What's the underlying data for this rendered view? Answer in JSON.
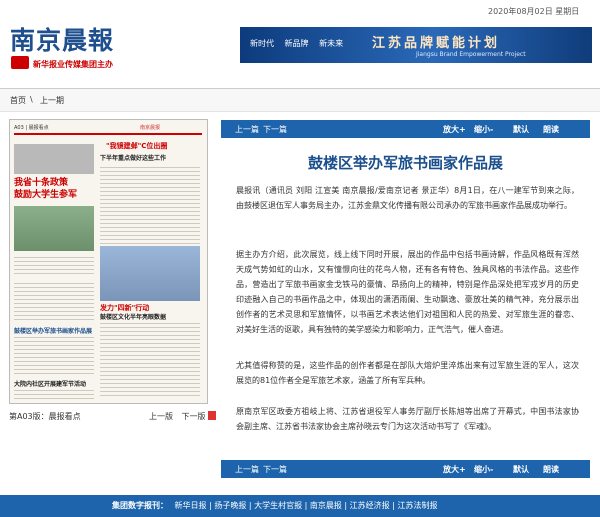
{
  "header": {
    "date": "2020年08月02日 星期日",
    "logo": "南京晨報",
    "org": "新华报业传媒集团主办",
    "banner": {
      "links": [
        "新时代",
        "新品牌",
        "新未来"
      ],
      "title": "江苏品牌赋能计划",
      "subtitle": "Jiangsu Brand Empowerment Project"
    }
  },
  "nav": {
    "home": "首页",
    "sep": "\\",
    "prev": "上一期"
  },
  "paper_thumb": {
    "header_left": "A03 | 晨报看点",
    "header_right": "南京晨报",
    "headline1": "\"我镜建邺\"C位出圈",
    "headline1_sub": "下半年重点做好这些工作",
    "headline2": "我省十条政策",
    "headline3": "鼓励大学生参军",
    "headline4": "发力\"四新\"行动",
    "headline4_sub": "鼓楼区文化半年亮眼数据",
    "headline5": "鼓楼区举办军旅书画家作品展",
    "headline6": "大院内社区开展建军节活动"
  },
  "page_nav": {
    "label": "第A03版：晨报看点",
    "prev_page": "上一版",
    "next_page": "下一版"
  },
  "toolbar": {
    "prev": "上一篇",
    "next": "下一篇",
    "zoom_in": "放大+",
    "zoom_out": "缩小-",
    "default": "默认",
    "read": "朗读"
  },
  "article": {
    "title": "鼓楼区举办军旅书画家作品展",
    "paragraphs": [
      "晨报讯（通讯员 刘阳 江宣美 南京晨报/爱南京记者 景正华）8月1日，在八一建军节到来之际，由鼓楼区退伍军人事务局主办，江苏金鼎文化传播有限公司承办的军旅书画家作品展成功举行。",
      "据主办方介绍，此次展览，线上线下同时开展，展出的作品中包括书画诗解，作品风格既有浑然天成气势如虹的山水，又有憧憬向往的花鸟人物，还有各有特色、独具风格的书法作品。这些作品，营造出了军旅书画家金戈铁马的豪情、昂扬向上的精神，特别是作品深处把军戎岁月的历史印迹融入自己的书画作品之中，体现出的潇洒雨阑、生动飘逸、豪放壮美的精气神，充分展示出创作者的艺术灵思和军旅情怀，以书画艺术表达他们对祖国和人民的热爱、对军旅生涯的眷恋、对美好生活的讴歌，具有独特的美学感染力和影响力，正气浩气，催人奋进。",
      "尤其值得称赞的是，这些作品的创作者都是在部队大熔炉里淬炼出来有过军旅生涯的军人，这次展览的81位作者全是军旅艺术家，涵盖了所有军兵种。",
      "原南京军区政委方祖岐上将、江苏省退役军人事务厅副厅长陈旭等出席了开幕式，中国书法家协会副主席、江苏省书法家协会主席孙晓云专门为这次活动书写了《军魂》。"
    ]
  },
  "footer": {
    "label": "集团数字报刊：",
    "links": [
      "新华日报",
      "扬子晚报",
      "大学生村官报",
      "南京晨报",
      "江苏经济报",
      "江苏法制报"
    ]
  }
}
